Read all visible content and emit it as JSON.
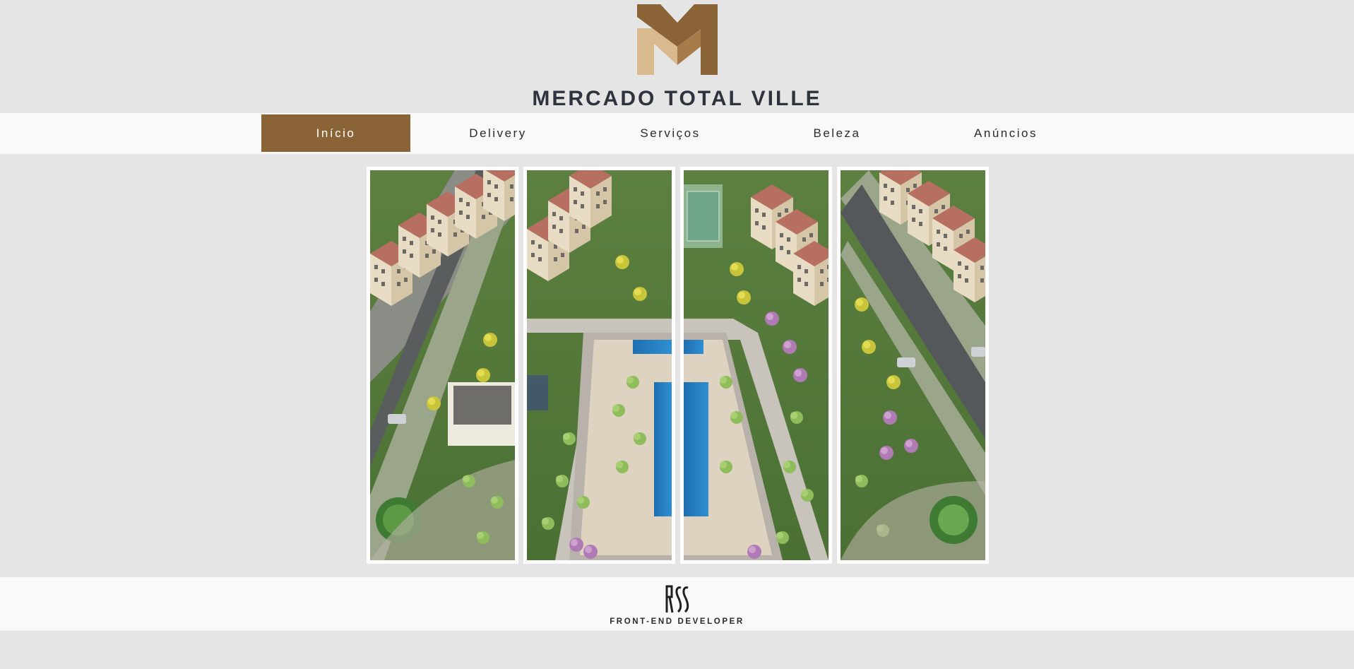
{
  "brand": {
    "name": "MERCADO TOTAL VILLE",
    "logo_icon": "m-monogram-icon",
    "colors": {
      "gold_dark": "#8a6437",
      "gold_light": "#d9b98e",
      "text": "#2f333d"
    }
  },
  "nav": {
    "items": [
      {
        "label": "Início",
        "active": true
      },
      {
        "label": "Delivery",
        "active": false
      },
      {
        "label": "Serviços",
        "active": false
      },
      {
        "label": "Beleza",
        "active": false
      },
      {
        "label": "Anúncios",
        "active": false
      }
    ],
    "active_color": "#8a6437"
  },
  "gallery": {
    "image": "aerial-condominium-render",
    "panels": 4
  },
  "footer": {
    "logo_icon": "rss-monogram-icon",
    "tagline": "FRONT-END DEVELOPER"
  }
}
